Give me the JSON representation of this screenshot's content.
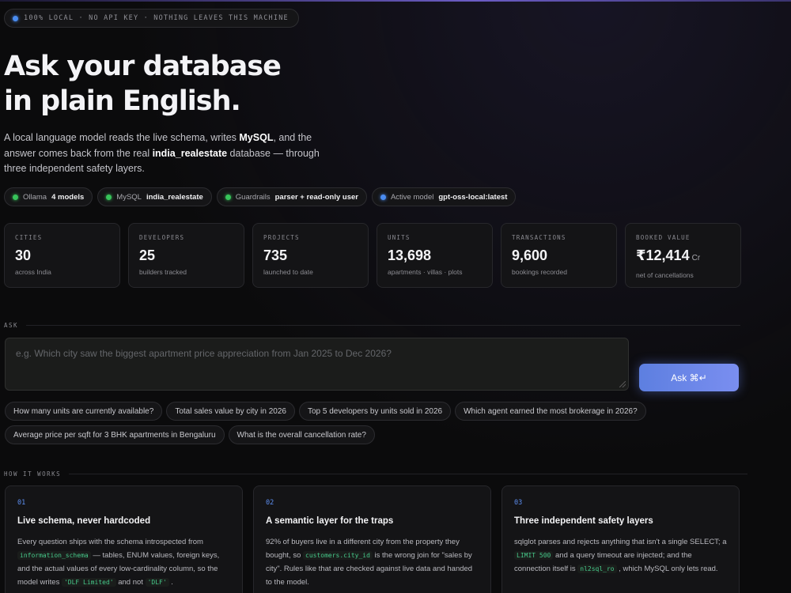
{
  "badge": {
    "text": "100% LOCAL · NO API KEY · NOTHING LEAVES THIS MACHINE",
    "dot_color": "#4a8cf0"
  },
  "hero": {
    "title_line1": "Ask your database",
    "title_line2": "in plain English.",
    "lead": {
      "p1": "A local language model reads the live schema, writes ",
      "b1": "MySQL",
      "p2": ", and the answer comes back from the real ",
      "b2": "india_realestate",
      "p3": " database — through three independent safety layers."
    }
  },
  "status": [
    {
      "label": "Ollama",
      "value": "4 models",
      "dot": "green"
    },
    {
      "label": "MySQL",
      "value": "india_realestate",
      "dot": "green"
    },
    {
      "label": "Guardrails",
      "value": "parser + read-only user",
      "dot": "green"
    },
    {
      "label": "Active model",
      "value": "gpt-oss-local:latest",
      "dot": "blue"
    }
  ],
  "stats": [
    {
      "label": "CITIES",
      "value": "30",
      "unit": "",
      "sub": "across India"
    },
    {
      "label": "DEVELOPERS",
      "value": "25",
      "unit": "",
      "sub": "builders tracked"
    },
    {
      "label": "PROJECTS",
      "value": "735",
      "unit": "",
      "sub": "launched to date"
    },
    {
      "label": "UNITS",
      "value": "13,698",
      "unit": "",
      "sub": "apartments · villas · plots"
    },
    {
      "label": "TRANSACTIONS",
      "value": "9,600",
      "unit": "",
      "sub": "bookings recorded"
    },
    {
      "label": "BOOKED VALUE",
      "value": "₹12,414",
      "unit": "Cr",
      "sub": "net of cancellations"
    }
  ],
  "ask": {
    "section_label": "ASK",
    "placeholder": "e.g.  Which city saw the biggest apartment price appreciation from Jan 2025 to Dec 2026?",
    "button_label": "Ask ⌘↵"
  },
  "suggestions": [
    "How many units are currently available?",
    "Total sales value by city in 2026",
    "Top 5 developers by units sold in 2026",
    "Which agent earned the most brokerage in 2026?",
    "Average price per sqft for 3 BHK apartments in Bengaluru",
    "What is the overall cancellation rate?"
  ],
  "how": {
    "section_label": "HOW IT WORKS",
    "cards": [
      {
        "num": "01",
        "title": "Live schema, never hardcoded",
        "t1": "Every question ships with the schema introspected from ",
        "c1": "information_schema",
        "t2": " — tables, ENUM values, foreign keys, and the actual values of every low-cardinality column, so the model writes ",
        "c2": "'DLF Limited'",
        "t3": " and not ",
        "c3": "'DLF'",
        "t4": " ."
      },
      {
        "num": "02",
        "title": "A semantic layer for the traps",
        "t1": "92% of buyers live in a different city from the property they bought, so ",
        "c1": "customers.city_id",
        "t2": " is the wrong join for \"sales by city\". Rules like that are checked against live data and handed to the model.",
        "c2": "",
        "t3": "",
        "c3": "",
        "t4": ""
      },
      {
        "num": "03",
        "title": "Three independent safety layers",
        "t1": "sqlglot parses and rejects anything that isn't a single SELECT; a ",
        "c1": "LIMIT 500",
        "t2": " and a query timeout are injected; and the connection itself is ",
        "c2": "nl2sql_ro",
        "t3": " , which MySQL only lets read.",
        "c3": "",
        "t4": ""
      }
    ]
  },
  "colors": {
    "accent": "#5d7fe0",
    "ok": "#37c45a",
    "code": "#46c98a"
  }
}
